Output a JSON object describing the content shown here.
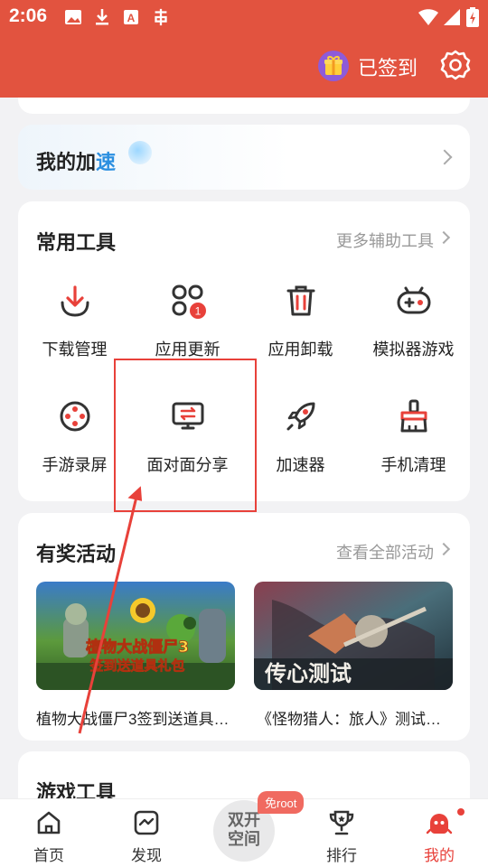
{
  "status_bar": {
    "time": "2:06"
  },
  "header": {
    "signin_label": "已签到"
  },
  "accelerate": {
    "title_main": "我的加",
    "title_accent": "速"
  },
  "tools": {
    "title": "常用工具",
    "more": "更多辅助工具",
    "badge": "1",
    "items": [
      {
        "label": "下载管理",
        "icon": "download-icon"
      },
      {
        "label": "应用更新",
        "icon": "app-update-icon"
      },
      {
        "label": "应用卸载",
        "icon": "trash-icon"
      },
      {
        "label": "模拟器游戏",
        "icon": "gamepad-icon"
      },
      {
        "label": "手游录屏",
        "icon": "film-reel-icon"
      },
      {
        "label": "面对面分享",
        "icon": "screen-share-icon"
      },
      {
        "label": "加速器",
        "icon": "rocket-icon"
      },
      {
        "label": "手机清理",
        "icon": "broom-icon"
      }
    ]
  },
  "activities": {
    "title": "有奖活动",
    "more": "查看全部活动",
    "items": [
      {
        "caption": "植物大战僵尸3签到送道具…",
        "banner_text": "植物大战僵尸3 签到送道具礼包"
      },
      {
        "caption": "《怪物猎人：旅人》测试…",
        "banner_text": "传心测试"
      }
    ]
  },
  "game_tools": {
    "title": "游戏工具"
  },
  "tabbar": {
    "items": [
      {
        "label": "首页",
        "icon": "home-icon"
      },
      {
        "label": "发现",
        "icon": "discover-icon"
      },
      {
        "label": "排行",
        "icon": "trophy-icon"
      },
      {
        "label": "我的",
        "icon": "profile-icon"
      }
    ],
    "center_line1": "双开",
    "center_line2": "空间",
    "center_badge": "免root"
  },
  "colors": {
    "brand": "#e2533f",
    "annotation": "#e8413a",
    "active_tab": "#e8413a"
  }
}
